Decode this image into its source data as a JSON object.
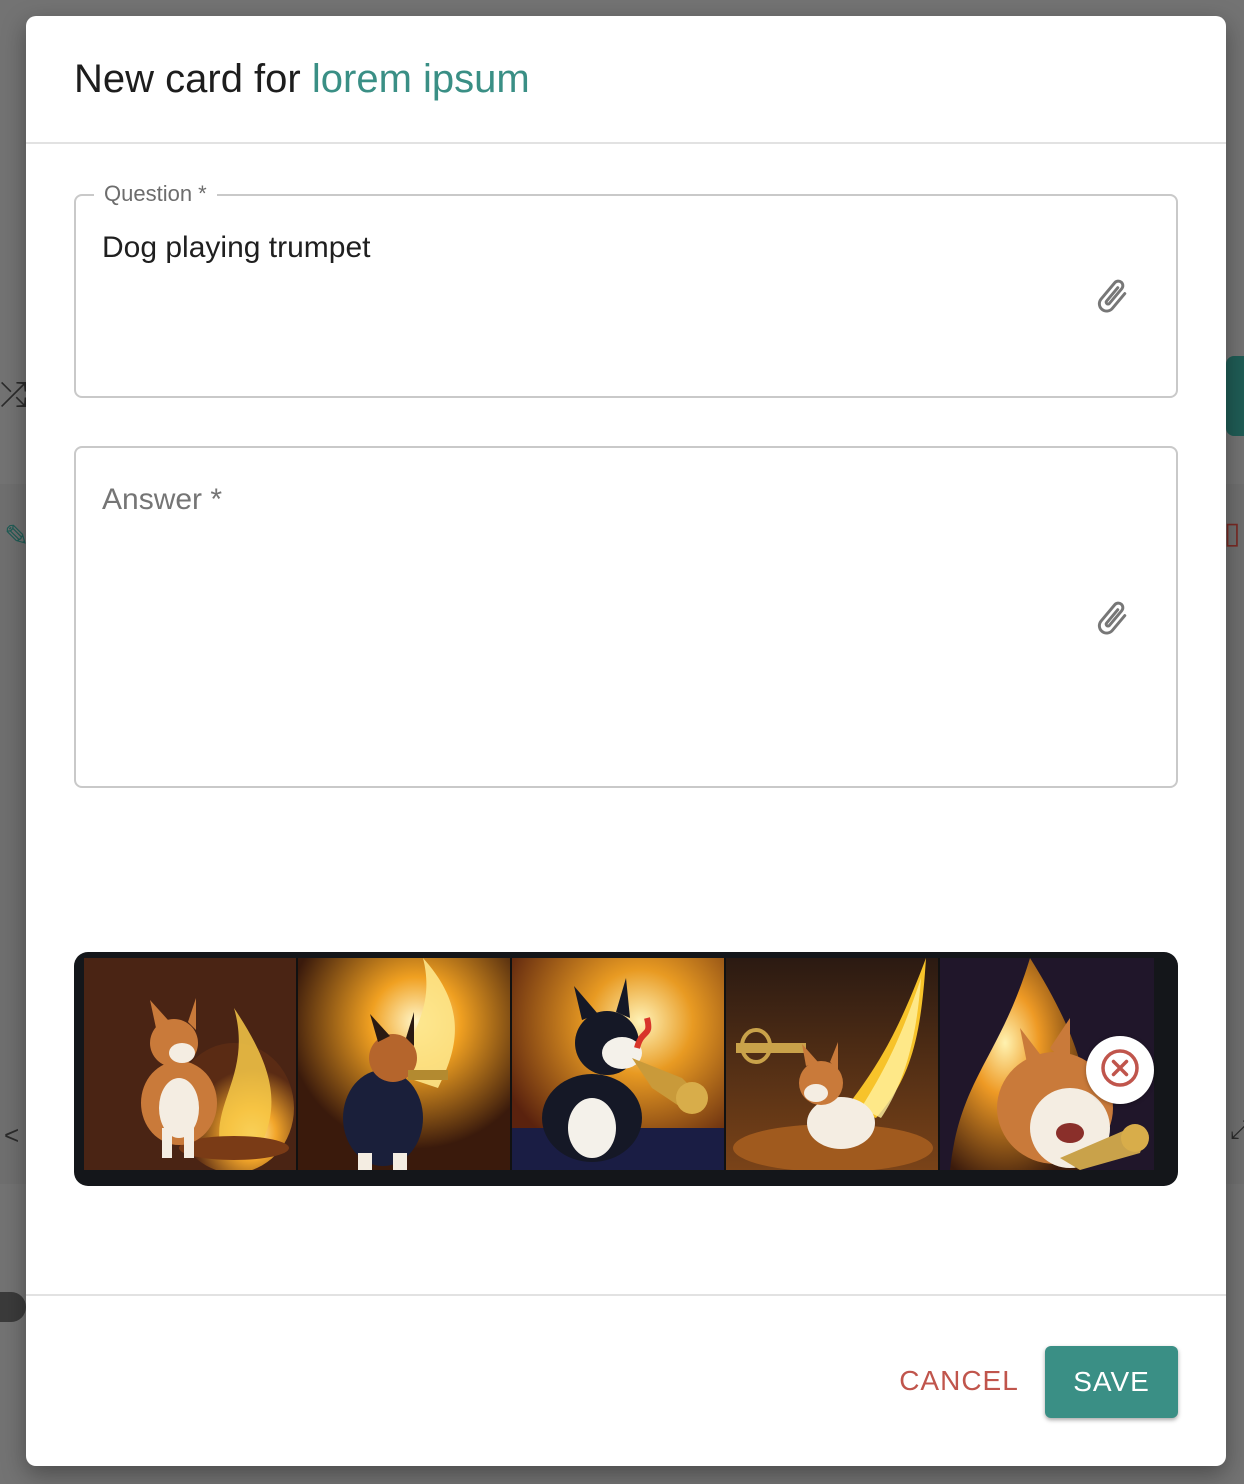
{
  "dialog": {
    "title_prefix": "New card for",
    "title_deck": "lorem ipsum"
  },
  "question": {
    "label": "Question *",
    "value": "Dog playing trumpet",
    "attach_icon": "paperclip-icon"
  },
  "answer": {
    "placeholder": "Answer *",
    "value": "",
    "attach_icon": "paperclip-icon"
  },
  "image_strip": {
    "images": [
      {
        "name": "corgi-by-fire"
      },
      {
        "name": "dog-with-torch"
      },
      {
        "name": "husky-playing-trumpet"
      },
      {
        "name": "corgi-with-trumpet-flame"
      },
      {
        "name": "corgi-blowing-trumpet"
      }
    ],
    "remove_icon": "close-circle-icon"
  },
  "footer": {
    "cancel_label": "CANCEL",
    "save_label": "SAVE"
  },
  "colors": {
    "accent": "#3a8f85",
    "cancel": "#c0554c",
    "overlay": "#737373"
  }
}
